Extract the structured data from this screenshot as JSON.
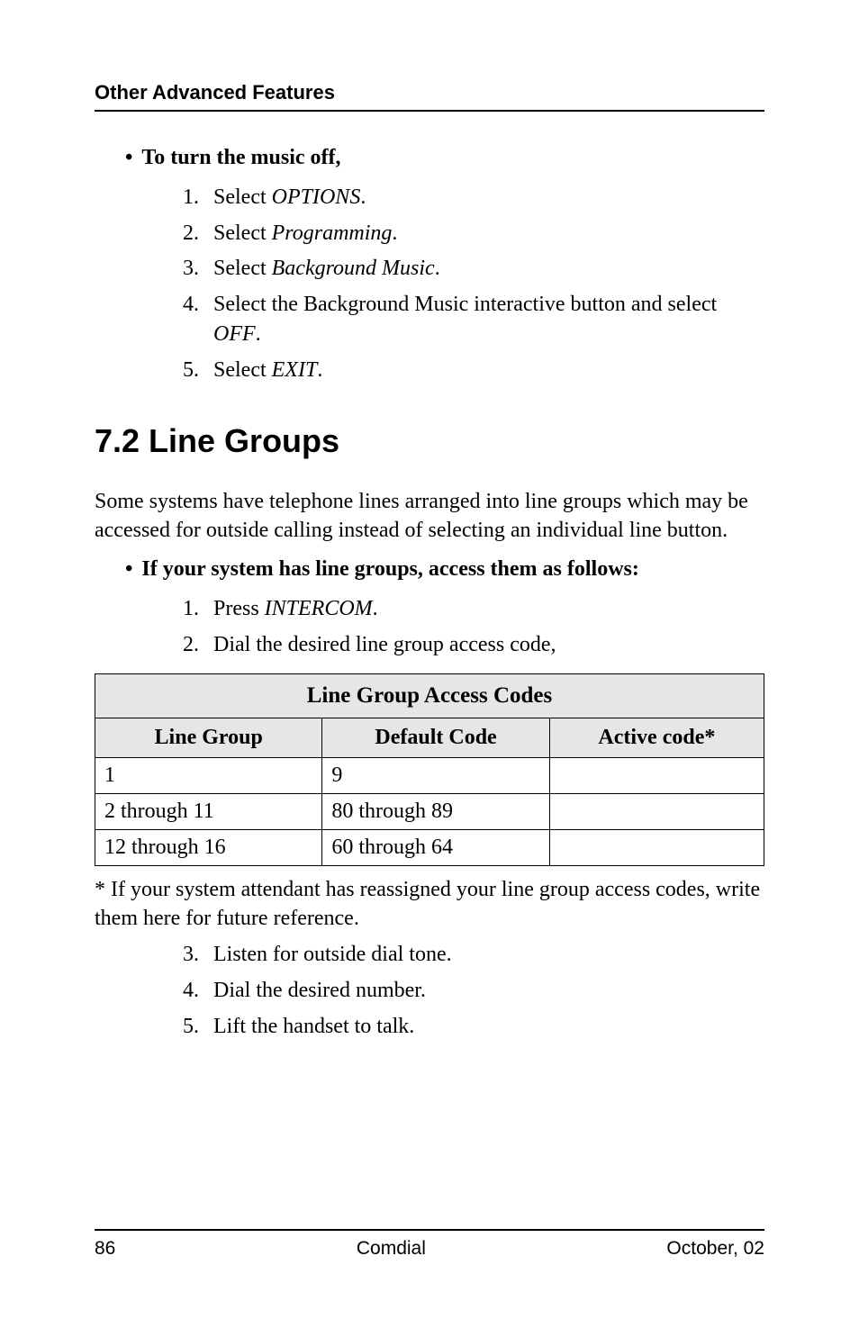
{
  "header": {
    "running": "Other Advanced Features"
  },
  "section1": {
    "bullet": "To turn the music off,",
    "items": [
      {
        "n": "1.",
        "pre": "Select  ",
        "it": "OPTIONS",
        "post": "."
      },
      {
        "n": "2.",
        "pre": "Select ",
        "it": "Programming",
        "post": "."
      },
      {
        "n": "3.",
        "pre": "Select ",
        "it": "Background  Music",
        "post": "."
      },
      {
        "n": "4.",
        "pre": "Select the Background Music interactive button and select ",
        "it": "OFF",
        "post": "."
      },
      {
        "n": "5.",
        "pre": "Select ",
        "it": "EXIT",
        "post": "."
      }
    ]
  },
  "h2": "7.2  Line Groups",
  "intro": "Some systems have telephone lines arranged into line groups which may be accessed for outside calling instead of selecting an individual line button.",
  "section2": {
    "bullet": "If your system has line groups, access them as follows:",
    "items_a": [
      {
        "n": "1.",
        "pre": "Press ",
        "it": "INTERCOM",
        "post": "."
      },
      {
        "n": "2.",
        "pre": "Dial the desired line group access code,",
        "it": "",
        "post": ""
      }
    ],
    "items_b": [
      {
        "n": "3.",
        "pre": "Listen  for outside dial tone.",
        "it": "",
        "post": ""
      },
      {
        "n": "4.",
        "pre": "Dial the desired number.",
        "it": "",
        "post": ""
      },
      {
        "n": "5.",
        "pre": "Lift the  handset to talk.",
        "it": "",
        "post": ""
      }
    ]
  },
  "table": {
    "title": "Line Group Access Codes",
    "cols": [
      "Line Group",
      "Default Code",
      "Active code*"
    ],
    "rows": [
      [
        "1",
        "9",
        ""
      ],
      [
        "2 through 11",
        "80 through 89",
        ""
      ],
      [
        "12 through 16",
        "60 through 64",
        ""
      ]
    ]
  },
  "footnote": "* If your system attendant has reassigned your line group access codes, write them here for future reference.",
  "footer": {
    "left": "86",
    "center": "Comdial",
    "right": "October, 02"
  },
  "chart_data": {
    "type": "table",
    "title": "Line Group Access Codes",
    "columns": [
      "Line Group",
      "Default Code",
      "Active code*"
    ],
    "rows": [
      {
        "Line Group": "1",
        "Default Code": "9",
        "Active code*": ""
      },
      {
        "Line Group": "2 through 11",
        "Default Code": "80 through 89",
        "Active code*": ""
      },
      {
        "Line Group": "12 through 16",
        "Default Code": "60 through 64",
        "Active code*": ""
      }
    ]
  }
}
